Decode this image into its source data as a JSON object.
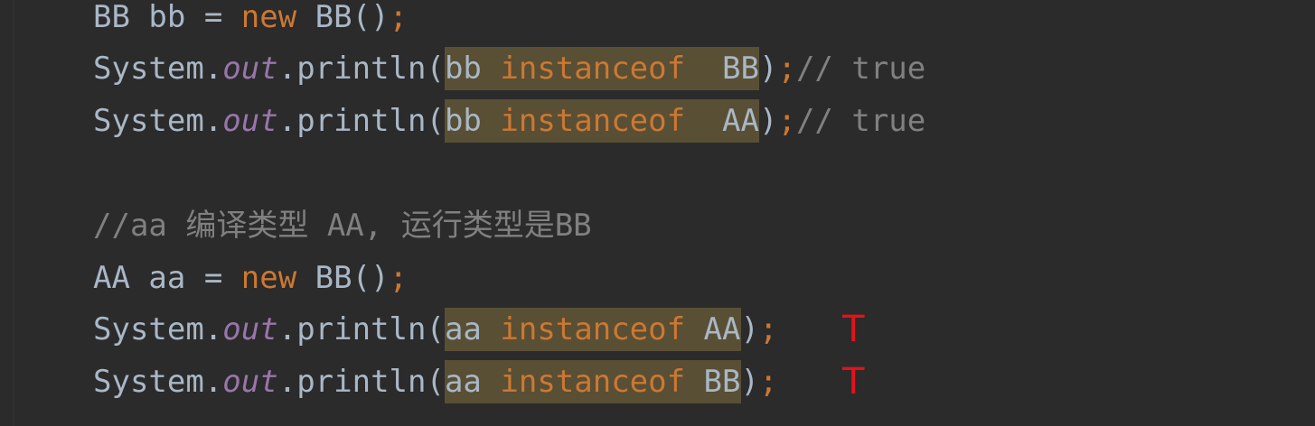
{
  "editor": {
    "lines": [
      {
        "id": "line-1",
        "tokens": [
          "BB bb = ",
          "new",
          " BB()",
          ";"
        ]
      },
      {
        "id": "line-2",
        "prefix": "System.",
        "field": "out",
        "call": ".println(",
        "hl_var": "bb ",
        "hl_kw": "instanceof",
        "hl_type": "  BB",
        "close": ")",
        "semi": ";",
        "comment": "// true"
      },
      {
        "id": "line-3",
        "prefix": "System.",
        "field": "out",
        "call": ".println(",
        "hl_var": "bb ",
        "hl_kw": "instanceof",
        "hl_type": "  AA",
        "close": ")",
        "semi": ";",
        "comment": "// true"
      },
      {
        "id": "line-5",
        "comment": "//aa 编译类型 AA, 运行类型是BB"
      },
      {
        "id": "line-6",
        "tokens": [
          "AA aa = ",
          "new",
          " BB()",
          ";"
        ]
      },
      {
        "id": "line-7",
        "prefix": "System.",
        "field": "out",
        "call": ".println(",
        "hl_var": "aa ",
        "hl_kw": "instanceof",
        "hl_type": " AA",
        "close": ")",
        "semi": ";",
        "annotation": "T"
      },
      {
        "id": "line-8",
        "prefix": "System.",
        "field": "out",
        "call": ".println(",
        "hl_var": "aa ",
        "hl_kw": "instanceof",
        "hl_type": " BB",
        "close": ")",
        "semi": ";",
        "annotation": "T"
      }
    ]
  },
  "colors": {
    "background": "#2b2b2b",
    "text": "#a9b7c6",
    "keyword": "#cc7832",
    "field": "#9876aa",
    "comment": "#808080",
    "highlight": "#5a5233",
    "annotation": "#e3121b"
  }
}
